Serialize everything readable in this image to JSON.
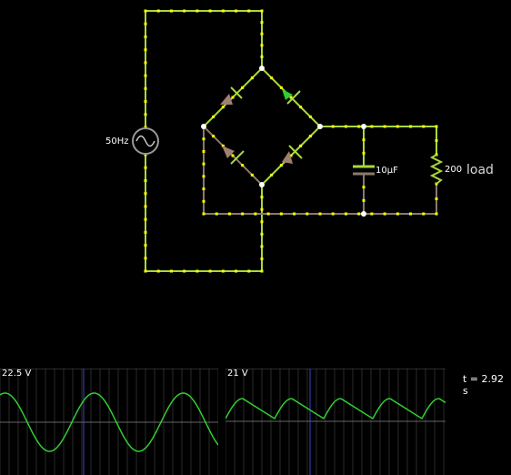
{
  "window": {
    "background": "#000000"
  },
  "circuit": {
    "source_label": "50Hz",
    "capacitor_label": "10µF",
    "resistor_label": "200",
    "load_label": "load",
    "colors": {
      "positive": "#a8d93b",
      "wire": "#ffff00",
      "ground": "#8a7a6a",
      "diode_fill": "#a08070"
    }
  },
  "scopes": [
    {
      "id": "scope-source",
      "max_label": "22.5 V",
      "waveform": "sine",
      "trace_color": "#33cc33"
    },
    {
      "id": "scope-load",
      "max_label": "21 V",
      "waveform": "rectified-ripple",
      "trace_color": "#33cc33"
    }
  ],
  "sim": {
    "time_label": "t = 2.92 s"
  }
}
